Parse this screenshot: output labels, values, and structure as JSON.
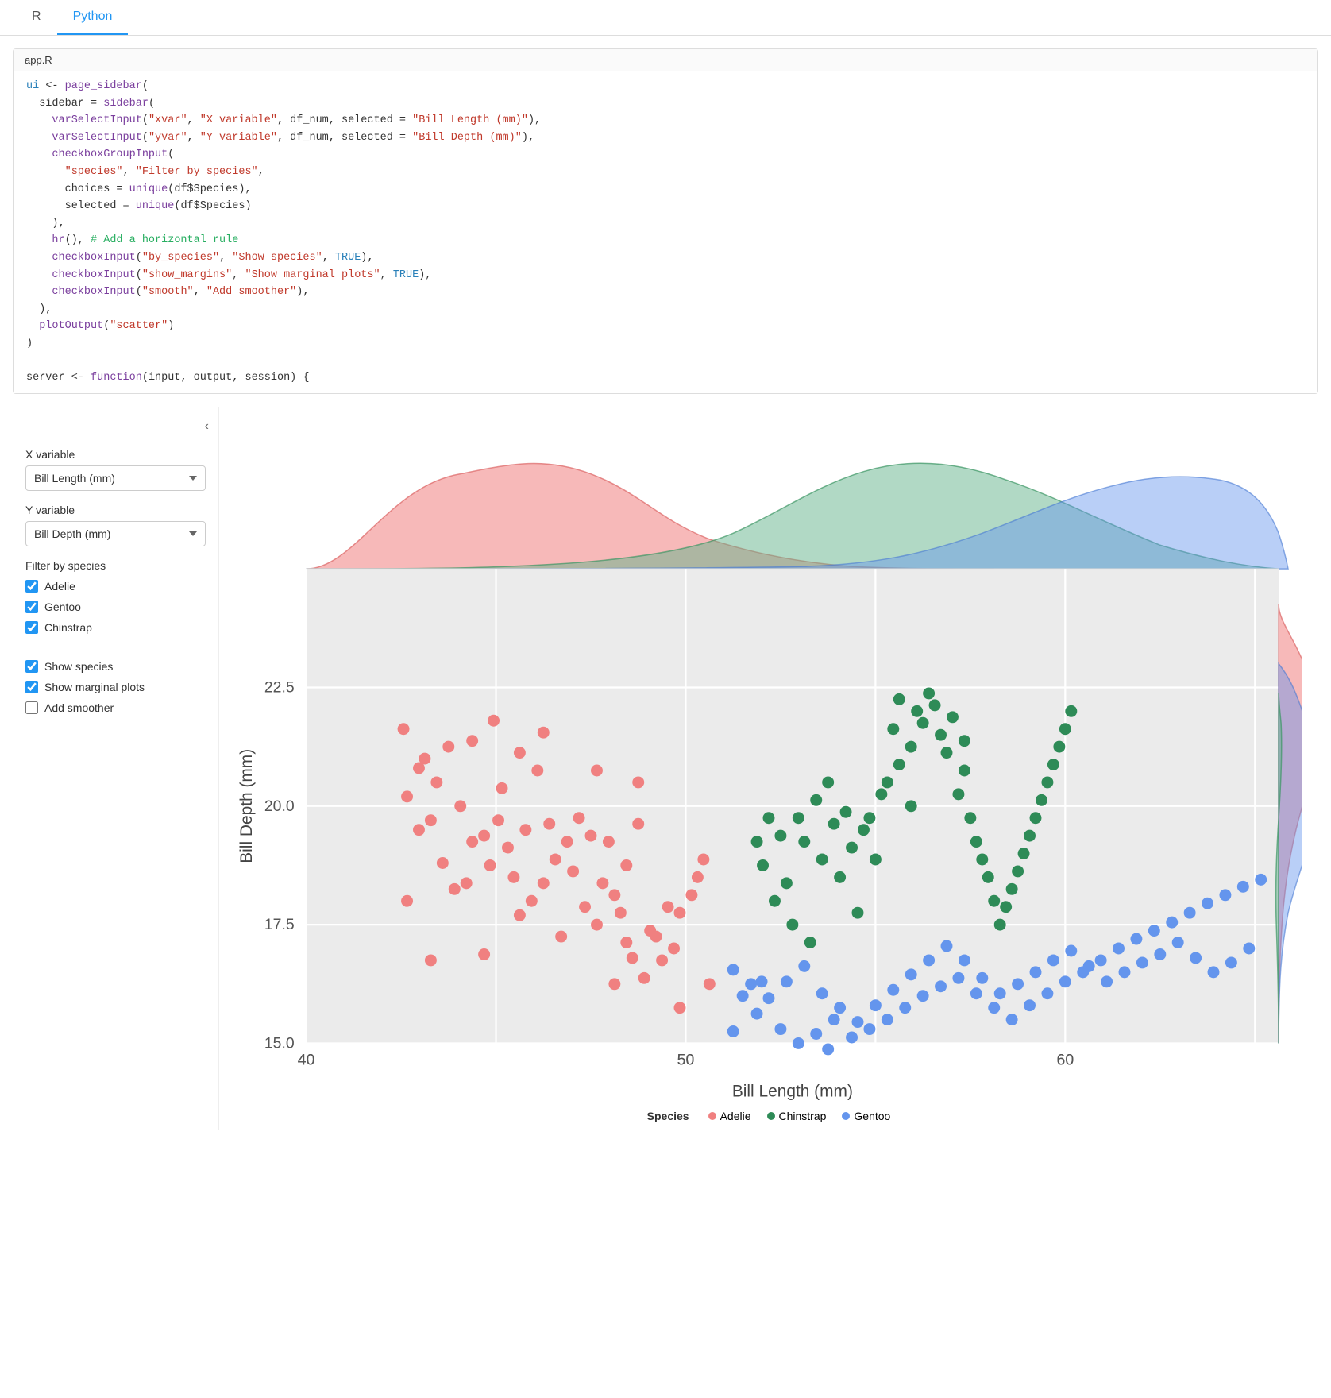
{
  "tabs": [
    {
      "label": "R",
      "active": false
    },
    {
      "label": "Python",
      "active": true
    }
  ],
  "code": {
    "filename": "app.R",
    "lines": [
      {
        "text": "ui <- page_sidebar(",
        "type": "mixed"
      },
      {
        "text": "  sidebar = sidebar(",
        "type": "mixed"
      },
      {
        "text": "    varSelectInput(\"xvar\", \"X variable\", df_num, selected = \"Bill Length (mm)\"),",
        "type": "mixed"
      },
      {
        "text": "    varSelectInput(\"yvar\", \"Y variable\", df_num, selected = \"Bill Depth (mm)\"),",
        "type": "mixed"
      },
      {
        "text": "    checkboxGroupInput(",
        "type": "mixed"
      },
      {
        "text": "      \"species\", \"Filter by species\",",
        "type": "mixed"
      },
      {
        "text": "      choices = unique(df$Species),",
        "type": "mixed"
      },
      {
        "text": "      selected = unique(df$Species)",
        "type": "mixed"
      },
      {
        "text": "    ),",
        "type": "plain"
      },
      {
        "text": "    hr(), # Add a horizontal rule",
        "type": "mixed"
      },
      {
        "text": "    checkboxInput(\"by_species\", \"Show species\", TRUE),",
        "type": "mixed"
      },
      {
        "text": "    checkboxInput(\"show_margins\", \"Show marginal plots\", TRUE),",
        "type": "mixed"
      },
      {
        "text": "    checkboxInput(\"smooth\", \"Add smoother\"),",
        "type": "mixed"
      },
      {
        "text": "  ),",
        "type": "plain"
      },
      {
        "text": "  plotOutput(\"scatter\")",
        "type": "mixed"
      },
      {
        "text": ")",
        "type": "plain"
      },
      {
        "text": "",
        "type": "plain"
      },
      {
        "text": "server <- function(input, output, session) {",
        "type": "mixed"
      }
    ]
  },
  "sidebar": {
    "collapse_icon": "‹",
    "x_variable_label": "X variable",
    "x_variable_value": "Bill Length (mm)",
    "y_variable_label": "Y variable",
    "y_variable_value": "Bill Depth (mm)",
    "filter_label": "Filter by species",
    "species": [
      {
        "label": "Adelie",
        "checked": true
      },
      {
        "label": "Gentoo",
        "checked": true
      },
      {
        "label": "Chinstrap",
        "checked": true
      }
    ],
    "show_species_label": "Show species",
    "show_species_checked": true,
    "show_marginal_label": "Show marginal plots",
    "show_marginal_checked": true,
    "add_smoother_label": "Add smoother",
    "add_smoother_checked": false
  },
  "chart": {
    "x_axis_label": "Bill Length (mm)",
    "y_axis_label": "Bill Depth (mm)",
    "legend_title": "Species",
    "legend_items": [
      {
        "label": "Adelie",
        "color": "#f08080"
      },
      {
        "label": "Chinstrap",
        "color": "#2e8b57"
      },
      {
        "label": "Gentoo",
        "color": "#6495ed"
      }
    ],
    "colors": {
      "adelie": "#f08080",
      "chinstrap": "#2e8b57",
      "gentoo": "#6495ed",
      "adelie_density": "rgba(240,128,128,0.5)",
      "chinstrap_density": "rgba(100,180,100,0.5)",
      "gentoo_density": "rgba(100,149,237,0.4)"
    }
  }
}
